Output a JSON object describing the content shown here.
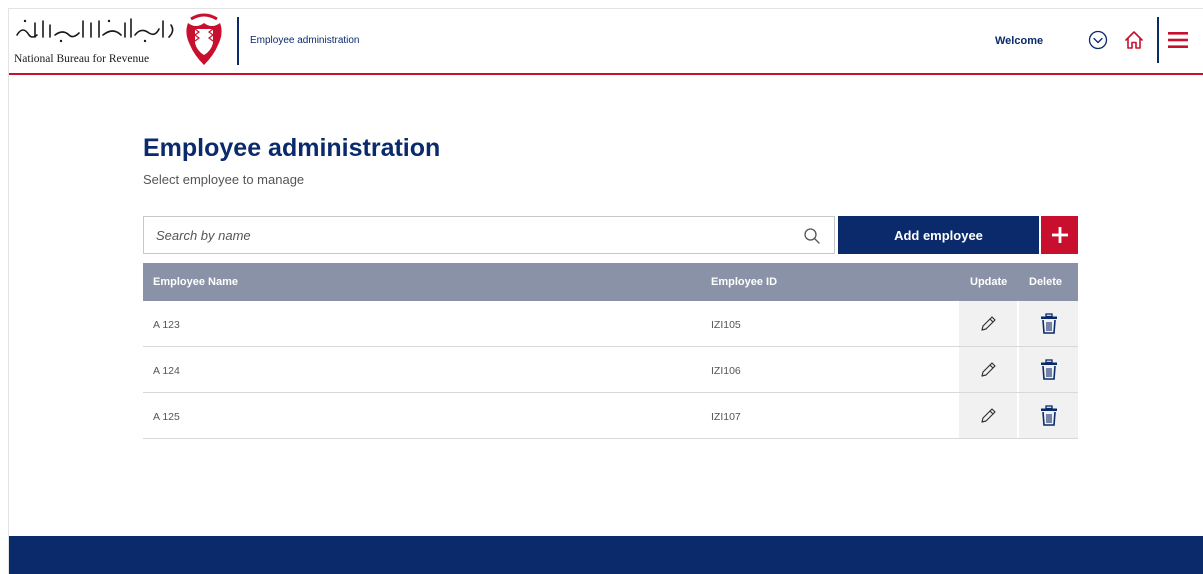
{
  "header": {
    "logo_arabic": "الجهاز الوطني للإيرادات",
    "logo_english": "National Bureau for Revenue",
    "section_title": "Employee administration",
    "welcome_label": "Welcome",
    "icons": {
      "account": "chevron-down-circle-icon",
      "home": "home-icon",
      "menu": "hamburger-menu-icon"
    },
    "colors": {
      "brand_blue": "#0a2a6b",
      "brand_red": "#c8102e"
    }
  },
  "main": {
    "title": "Employee administration",
    "subtitle": "Select employee to manage",
    "search": {
      "placeholder": "Search by name",
      "value": ""
    },
    "add_button_label": "Add employee",
    "table": {
      "headers": {
        "name": "Employee Name",
        "id": "Employee ID",
        "update": "Update",
        "delete": "Delete"
      },
      "rows": [
        {
          "name": "A 123",
          "id": "IZI105"
        },
        {
          "name": "A 124",
          "id": "IZI106"
        },
        {
          "name": "A 125",
          "id": "IZI107"
        }
      ]
    }
  },
  "footer": {
    "color": "#0a2a6b"
  }
}
